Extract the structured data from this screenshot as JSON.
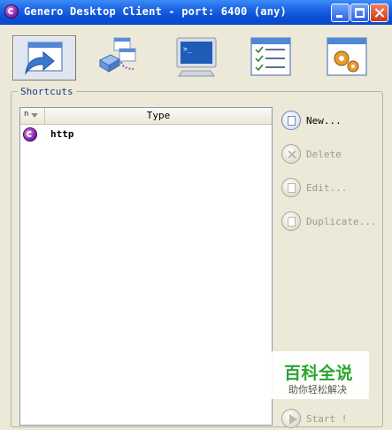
{
  "window": {
    "title": "Genero Desktop Client - port: 6400 (any)"
  },
  "toolbar": {
    "buttons": [
      {
        "name": "shortcuts-icon",
        "active": true
      },
      {
        "name": "network-icon",
        "active": false
      },
      {
        "name": "console-icon",
        "active": false
      },
      {
        "name": "list-icon",
        "active": false
      },
      {
        "name": "settings-icon",
        "active": false
      }
    ]
  },
  "shortcuts": {
    "group_label": "Shortcuts",
    "columns": {
      "n": "n",
      "type": "Type"
    },
    "rows": [
      {
        "type": "http"
      }
    ]
  },
  "actions": {
    "new": "New...",
    "delete": "Delete",
    "edit": "Edit...",
    "duplicate": "Duplicate...",
    "start": "Start !"
  },
  "watermark": {
    "title": "百科全说",
    "subtitle": "助你轻松解决"
  }
}
